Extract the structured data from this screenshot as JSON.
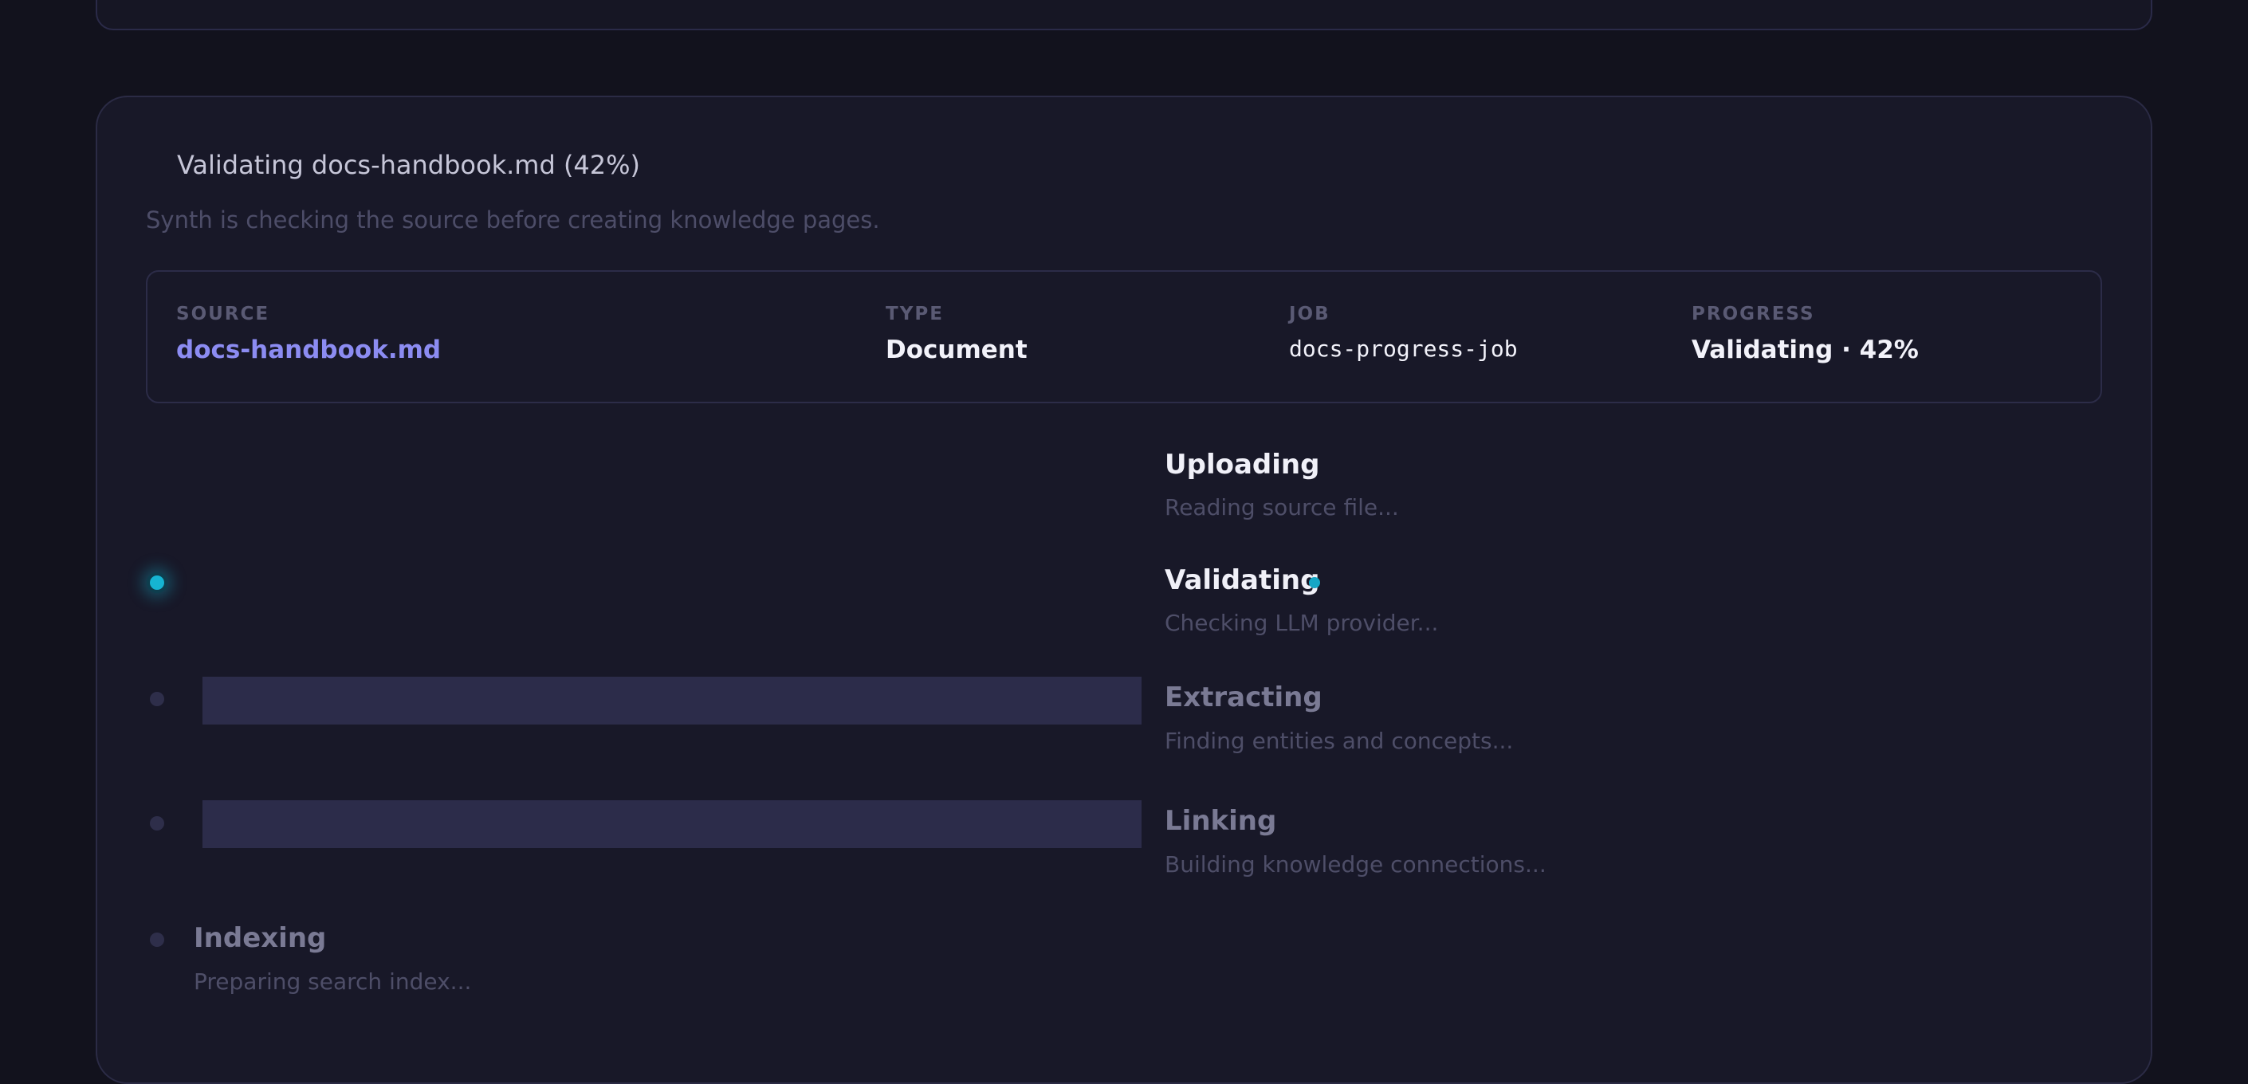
{
  "header": {
    "title": "Validating docs-handbook.md (42%)",
    "subtitle": "Synth is checking the source before creating knowledge pages."
  },
  "info": {
    "source_label": "SOURCE",
    "source_value": "docs-handbook.md",
    "type_label": "TYPE",
    "type_value": "Document",
    "job_label": "JOB",
    "job_value": "docs-progress-job",
    "progress_label": "PROGRESS",
    "progress_value": "Validating · 42%"
  },
  "progress_percent": 42,
  "steps": [
    {
      "title": "Uploading",
      "desc": "Reading source file...",
      "state": "done"
    },
    {
      "title": "Validating",
      "desc": "Checking LLM provider...",
      "state": "active"
    },
    {
      "title": "Extracting",
      "desc": "Finding entities and concepts...",
      "state": "pending"
    },
    {
      "title": "Linking",
      "desc": "Building knowledge connections...",
      "state": "pending"
    },
    {
      "title": "Indexing",
      "desc": "Preparing search index...",
      "state": "pending"
    }
  ],
  "colors": {
    "accent": "#16b4d2",
    "link": "#8c8cf2",
    "background": "#12121d",
    "card": "#181828"
  }
}
